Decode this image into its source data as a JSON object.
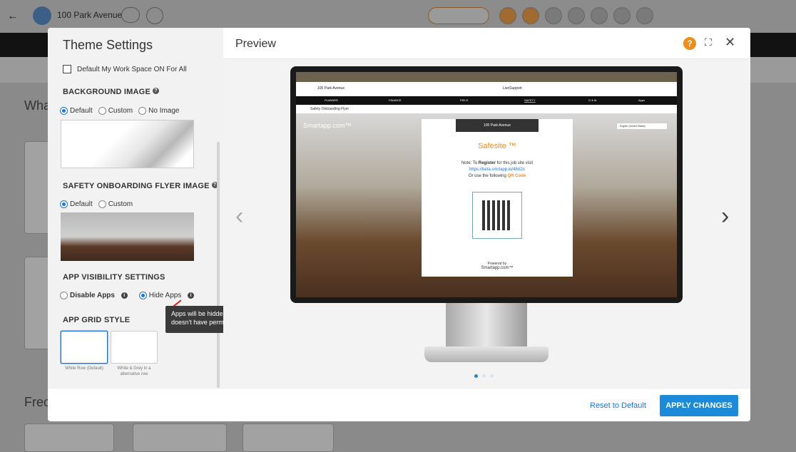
{
  "background": {
    "location": "100 Park Avenue",
    "section_title_partial": "Wha",
    "recent_title_partial": "Frec"
  },
  "modal": {
    "left_title": "Theme Settings",
    "default_workspace_label": "Default My Work Space ON For All",
    "background_image": {
      "title": "BACKGROUND IMAGE",
      "options": [
        "Default",
        "Custom",
        "No Image"
      ],
      "selected": "Default"
    },
    "flyer_image": {
      "title": "SAFETY ONBOARDING FLYER IMAGE",
      "options": [
        "Default",
        "Custom"
      ],
      "selected": "Default"
    },
    "app_visibility": {
      "title": "APP VISIBILITY SETTINGS",
      "disable_label": "Disable Apps",
      "hide_label": "Hide Apps",
      "selected": "Hide Apps"
    },
    "tooltip": "Apps will be hidden if the logged-in user doesn't have permission",
    "grid_style": {
      "title": "APP GRID STYLE",
      "options": [
        {
          "label": "White Row (Default)"
        },
        {
          "label": "White & Grey in a alternative row"
        }
      ]
    },
    "preview_title": "Preview",
    "preview": {
      "location": "100 Park Avenue",
      "live_support": "LiveSupport",
      "nav_items": [
        "PLANNER",
        "FINANCE",
        "FIELD",
        "SAFETY",
        "O & M",
        "Apps"
      ],
      "breadcrumb": "Safety Onboarding Flyer",
      "brand": "Smartapp.com™",
      "card_header": "100 Park Avenue",
      "safesite": "Safesite ™",
      "note_line1_pre": "Note: To ",
      "note_line1_bold": "Register",
      "note_line1_post": " for this job site visit",
      "note_link": "https://beta.smrtapp.io/48rr2s",
      "note_line3_pre": "Or use the following ",
      "note_line3_em": "QR Code",
      "powered_by": "Powered by",
      "powered_brand": "Smartapp.com™",
      "language": "English (United States)"
    },
    "reset_label": "Reset to Default",
    "apply_label": "APPLY CHANGES"
  },
  "colors": {
    "accent": "#1b8ad8",
    "orange": "#f28c18"
  }
}
